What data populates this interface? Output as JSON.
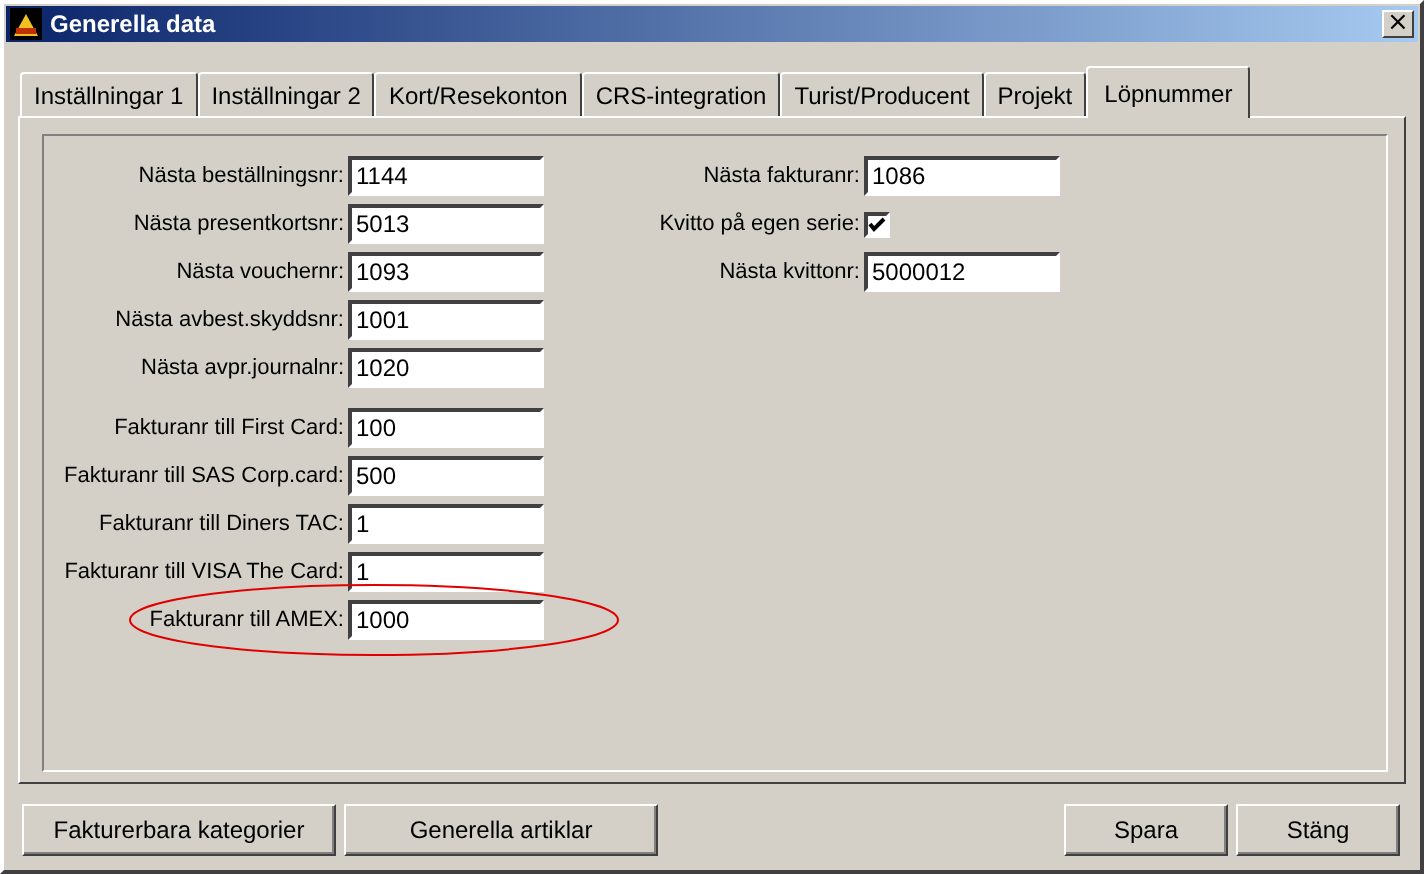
{
  "window": {
    "title": "Generella data",
    "close": "×"
  },
  "tabs": [
    {
      "label": "Inställningar 1",
      "selected": false
    },
    {
      "label": "Inställningar 2",
      "selected": false
    },
    {
      "label": "Kort/Resekonton",
      "selected": false
    },
    {
      "label": "CRS-integration",
      "selected": false
    },
    {
      "label": "Turist/Producent",
      "selected": false
    },
    {
      "label": "Projekt",
      "selected": false
    },
    {
      "label": "Löpnummer",
      "selected": true
    }
  ],
  "left_groups": [
    [
      {
        "label": "Nästa beställningsnr:",
        "value": "1144"
      },
      {
        "label": "Nästa presentkortsnr:",
        "value": "5013"
      },
      {
        "label": "Nästa vouchernr:",
        "value": "1093"
      },
      {
        "label": "Nästa avbest.skyddsnr:",
        "value": "1001"
      },
      {
        "label": "Nästa avpr.journalnr:",
        "value": "1020"
      }
    ],
    [
      {
        "label": "Fakturanr till First Card:",
        "value": "100"
      },
      {
        "label": "Fakturanr till SAS Corp.card:",
        "value": "500"
      },
      {
        "label": "Fakturanr till Diners TAC:",
        "value": "1"
      },
      {
        "label": "Fakturanr till VISA The Card:",
        "value": "1"
      },
      {
        "label": "Fakturanr till AMEX:",
        "value": "1000"
      }
    ]
  ],
  "right_fields": [
    {
      "kind": "field",
      "label": "Nästa fakturanr:",
      "value": "1086"
    },
    {
      "kind": "checkbox",
      "label": "Kvitto på egen serie:",
      "checked": true
    },
    {
      "kind": "field",
      "label": "Nästa kvittonr:",
      "value": "5000012"
    }
  ],
  "buttons_left": [
    "Fakturerbara kategorier",
    "Generella artiklar"
  ],
  "buttons_right": [
    "Spara",
    "Stäng"
  ]
}
